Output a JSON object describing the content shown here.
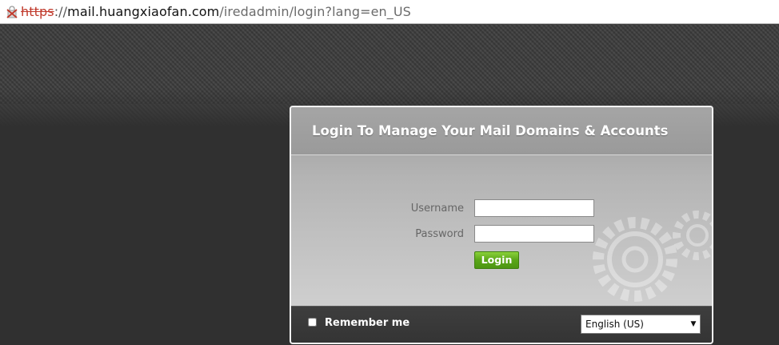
{
  "address_bar": {
    "scheme": "https",
    "separator": "://",
    "host": "mail.huangxiaofan.com",
    "path": "/iredadmin/login?lang=en_US",
    "ssl_icon": "broken-lock-icon"
  },
  "panel": {
    "title": "Login To Manage Your Mail Domains & Accounts",
    "username_label": "Username",
    "username_value": "",
    "password_label": "Password",
    "password_value": "",
    "login_label": "Login",
    "remember_label": "Remember me",
    "remember_checked": false,
    "language_selected": "English (US)",
    "language_arrow": "▼"
  },
  "colors": {
    "login_button": "#5aa618",
    "panel_bg": "#b4b4b4",
    "footer_bg": "#3a3a3a",
    "page_bg": "#303030",
    "insecure_scheme": "#c0392b"
  }
}
